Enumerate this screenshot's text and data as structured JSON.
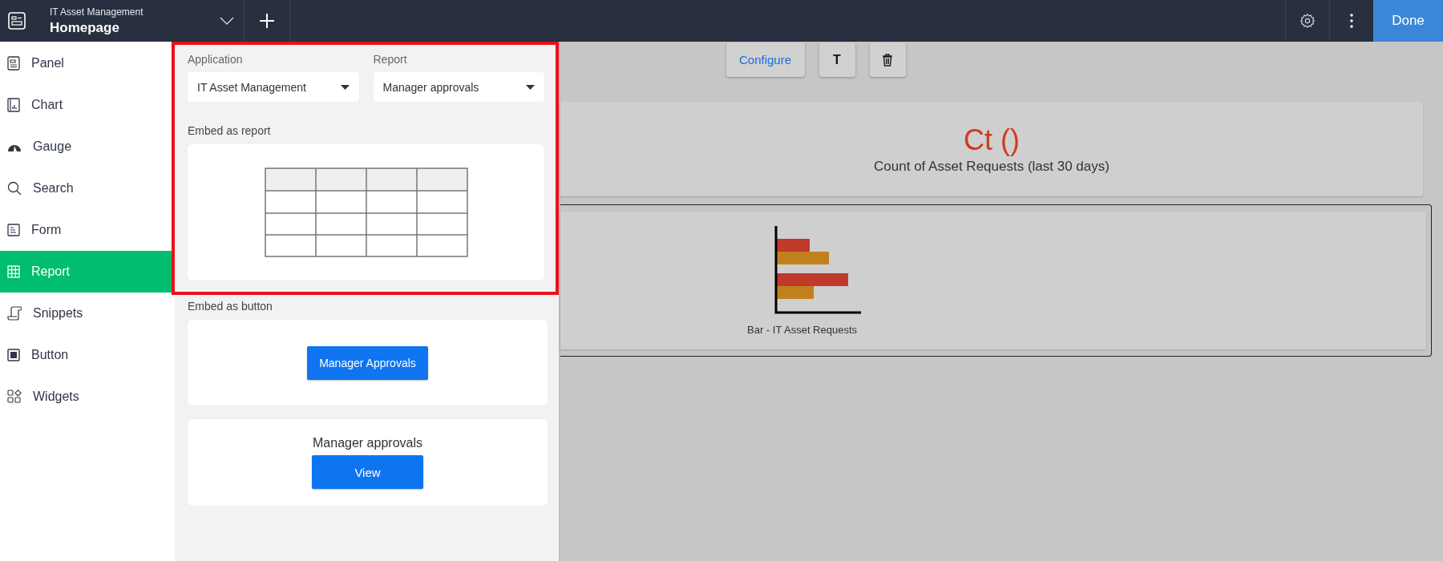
{
  "header": {
    "app_name": "IT Asset Management",
    "page_title": "Homepage",
    "done_button": "Done"
  },
  "sidebar": {
    "items": [
      {
        "label": "Panel",
        "kind": "panel",
        "selected": false
      },
      {
        "label": "Chart",
        "kind": "chart",
        "selected": false
      },
      {
        "label": "Gauge",
        "kind": "gauge",
        "selected": false
      },
      {
        "label": "Search",
        "kind": "search",
        "selected": false
      },
      {
        "label": "Form",
        "kind": "form",
        "selected": false
      },
      {
        "label": "Report",
        "kind": "report",
        "selected": true
      },
      {
        "label": "Snippets",
        "kind": "snippets",
        "selected": false
      },
      {
        "label": "Button",
        "kind": "button",
        "selected": false
      },
      {
        "label": "Widgets",
        "kind": "widgets",
        "selected": false
      }
    ]
  },
  "settings_panel": {
    "application": {
      "label": "Application",
      "value": "IT Asset Management"
    },
    "report": {
      "label": "Report",
      "value": "Manager approvals"
    },
    "embed_report_label": "Embed as report",
    "embed_button_label": "Embed as button",
    "embed_button": "Manager Approvals",
    "view_card": {
      "title": "Manager approvals",
      "button": "View"
    }
  },
  "canvas": {
    "toolbar": {
      "configure": "Configure",
      "text_button": "T"
    },
    "kpi_card": {
      "value": "Ct ()",
      "caption": "Count of Asset Requests (last 30 days)"
    },
    "chart_card": {
      "caption": "Bar - IT Asset Requests",
      "selected": true
    }
  }
}
